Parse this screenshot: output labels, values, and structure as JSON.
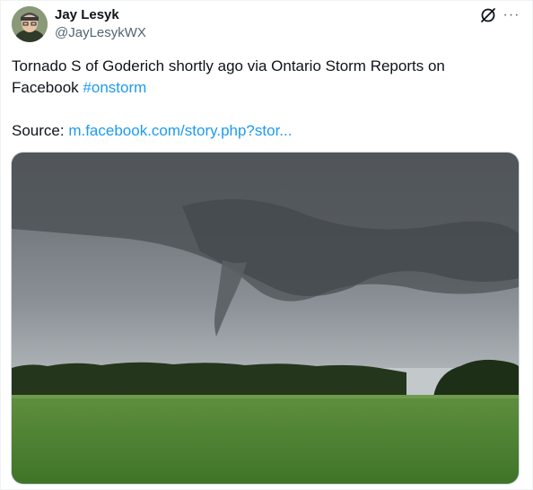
{
  "author": {
    "display_name": "Jay Lesyk",
    "handle": "@JayLesykWX"
  },
  "header_icons": [
    "grok-icon",
    "more-icon"
  ],
  "more_label": "···",
  "tweet": {
    "text": "Tornado S of Goderich shortly ago via Ontario Storm Reports on Facebook",
    "hashtag": "#onstorm",
    "source_prefix": "Source:",
    "source_link": "m.facebook.com/story.php?stor..."
  },
  "colors": {
    "text": "#0f1419",
    "secondary": "#536471",
    "link": "#1d9bf0"
  }
}
